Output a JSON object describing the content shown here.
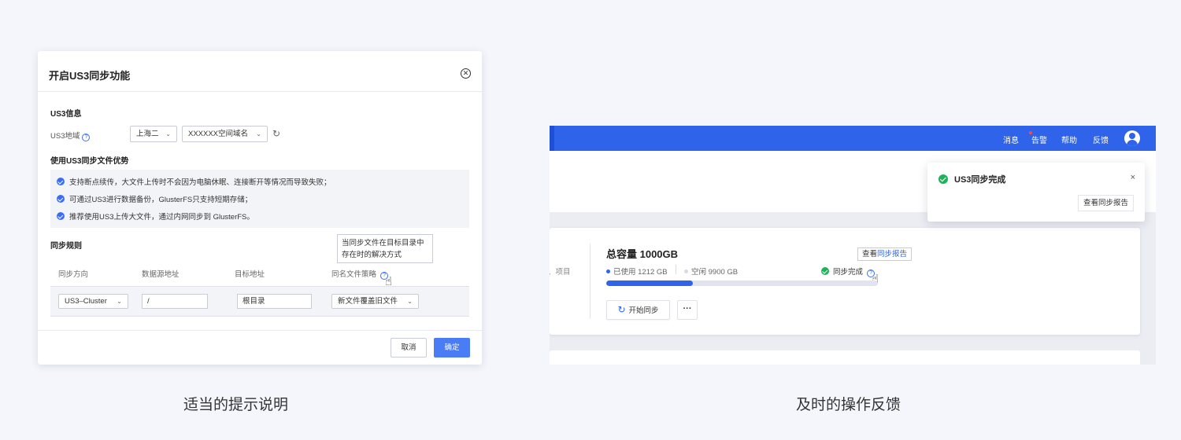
{
  "dialog": {
    "title": "开启US3同步功能",
    "close_icon": "✕",
    "section_info": "US3信息",
    "region_label": "US3地域",
    "help_icon": "?",
    "region_value": "上海二",
    "domain_value": "XXXXXX空间域名",
    "refresh_icon": "↻",
    "section_advantages": "使用US3同步文件优势",
    "advantages": [
      "支持断点续传，大文件上传时不会因为电脑休眠、连接断开等情况而导致失败；",
      "可通过US3进行数据备份，GlusterFS只支持短期存储；",
      "推荐使用US3上传大文件，通过内网同步到 GlusterFS。"
    ],
    "section_rules": "同步规则",
    "tooltip_line1": "当同步文件在目标目录中",
    "tooltip_line2": "存在时的解决方式",
    "columns": [
      "同步方向",
      "数据源地址",
      "目标地址",
      "同名文件策略"
    ],
    "row": {
      "direction": "US3–Cluster",
      "source": "/",
      "target": "根目录",
      "strategy": "新文件覆盖旧文件"
    },
    "cancel_label": "取消",
    "ok_label": "确定"
  },
  "captions": {
    "left": "适当的提示说明",
    "right": "及时的操作反馈"
  },
  "console": {
    "nav": [
      "消息",
      "告警",
      "帮助",
      "反馈"
    ],
    "crumb": "、项目",
    "capacity_title": "总容量 1000GB",
    "used_label": "已使用 1212 GB",
    "free_label": "空闲 9900 GB",
    "used_progress_fraction": 0.32,
    "report_prefix": "查看",
    "report_link": "同步报告",
    "status_label": "同步完成",
    "sync_button": "开始同步",
    "more_button": "···",
    "notification": {
      "title": "US3同步完成",
      "close": "×",
      "button": "查看同步报告"
    }
  },
  "colors": {
    "primary": "#2f63ea",
    "success": "#1eb35a",
    "alert_dot": "#f54a45"
  }
}
